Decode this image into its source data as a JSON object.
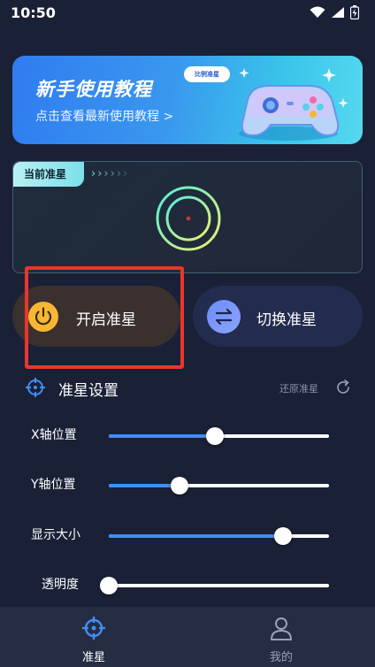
{
  "status_bar": {
    "time": "10:50"
  },
  "banner": {
    "title": "新手使用教程",
    "badge": "比例准星",
    "subtitle": "点击查看最新使用教程 >"
  },
  "crosshair_panel": {
    "tag": "当前准星",
    "arrows": [
      "›",
      "›",
      "›",
      "›",
      "›",
      "›",
      "›",
      "›"
    ]
  },
  "actions": {
    "start_label": "开启准星",
    "switch_label": "切换准星"
  },
  "settings": {
    "title": "准星设置",
    "reset_label": "还原准星",
    "sliders": [
      {
        "label": "X轴位置",
        "value": 0.48
      },
      {
        "label": "Y轴位置",
        "value": 0.32
      },
      {
        "label": "显示大小",
        "value": 0.79
      },
      {
        "label": "透明度",
        "value": 0.0
      }
    ]
  },
  "tabbar": {
    "tabs": [
      {
        "label": "准星",
        "active": true
      },
      {
        "label": "我的",
        "active": false
      }
    ]
  },
  "colors": {
    "background": "#1a2036",
    "accent": "#3f8ef5",
    "start_button_icon": "#f7b733",
    "highlight": "#e8372c"
  }
}
